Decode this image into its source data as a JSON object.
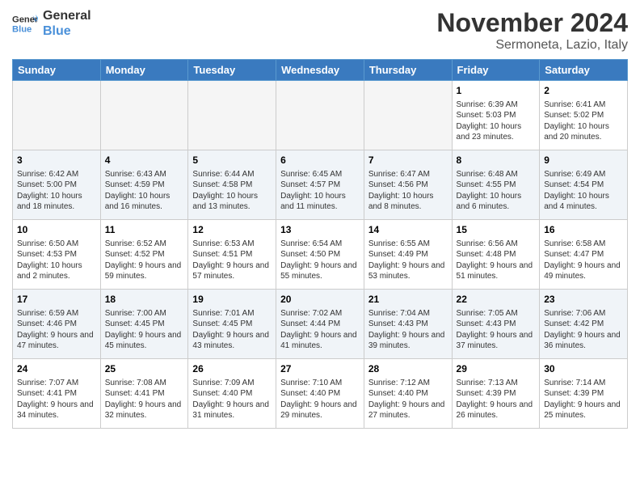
{
  "header": {
    "logo_line1": "General",
    "logo_line2": "Blue",
    "month_title": "November 2024",
    "location": "Sermoneta, Lazio, Italy"
  },
  "weekdays": [
    "Sunday",
    "Monday",
    "Tuesday",
    "Wednesday",
    "Thursday",
    "Friday",
    "Saturday"
  ],
  "weeks": [
    [
      {
        "day": "",
        "info": ""
      },
      {
        "day": "",
        "info": ""
      },
      {
        "day": "",
        "info": ""
      },
      {
        "day": "",
        "info": ""
      },
      {
        "day": "",
        "info": ""
      },
      {
        "day": "1",
        "info": "Sunrise: 6:39 AM\nSunset: 5:03 PM\nDaylight: 10 hours and 23 minutes."
      },
      {
        "day": "2",
        "info": "Sunrise: 6:41 AM\nSunset: 5:02 PM\nDaylight: 10 hours and 20 minutes."
      }
    ],
    [
      {
        "day": "3",
        "info": "Sunrise: 6:42 AM\nSunset: 5:00 PM\nDaylight: 10 hours and 18 minutes."
      },
      {
        "day": "4",
        "info": "Sunrise: 6:43 AM\nSunset: 4:59 PM\nDaylight: 10 hours and 16 minutes."
      },
      {
        "day": "5",
        "info": "Sunrise: 6:44 AM\nSunset: 4:58 PM\nDaylight: 10 hours and 13 minutes."
      },
      {
        "day": "6",
        "info": "Sunrise: 6:45 AM\nSunset: 4:57 PM\nDaylight: 10 hours and 11 minutes."
      },
      {
        "day": "7",
        "info": "Sunrise: 6:47 AM\nSunset: 4:56 PM\nDaylight: 10 hours and 8 minutes."
      },
      {
        "day": "8",
        "info": "Sunrise: 6:48 AM\nSunset: 4:55 PM\nDaylight: 10 hours and 6 minutes."
      },
      {
        "day": "9",
        "info": "Sunrise: 6:49 AM\nSunset: 4:54 PM\nDaylight: 10 hours and 4 minutes."
      }
    ],
    [
      {
        "day": "10",
        "info": "Sunrise: 6:50 AM\nSunset: 4:53 PM\nDaylight: 10 hours and 2 minutes."
      },
      {
        "day": "11",
        "info": "Sunrise: 6:52 AM\nSunset: 4:52 PM\nDaylight: 9 hours and 59 minutes."
      },
      {
        "day": "12",
        "info": "Sunrise: 6:53 AM\nSunset: 4:51 PM\nDaylight: 9 hours and 57 minutes."
      },
      {
        "day": "13",
        "info": "Sunrise: 6:54 AM\nSunset: 4:50 PM\nDaylight: 9 hours and 55 minutes."
      },
      {
        "day": "14",
        "info": "Sunrise: 6:55 AM\nSunset: 4:49 PM\nDaylight: 9 hours and 53 minutes."
      },
      {
        "day": "15",
        "info": "Sunrise: 6:56 AM\nSunset: 4:48 PM\nDaylight: 9 hours and 51 minutes."
      },
      {
        "day": "16",
        "info": "Sunrise: 6:58 AM\nSunset: 4:47 PM\nDaylight: 9 hours and 49 minutes."
      }
    ],
    [
      {
        "day": "17",
        "info": "Sunrise: 6:59 AM\nSunset: 4:46 PM\nDaylight: 9 hours and 47 minutes."
      },
      {
        "day": "18",
        "info": "Sunrise: 7:00 AM\nSunset: 4:45 PM\nDaylight: 9 hours and 45 minutes."
      },
      {
        "day": "19",
        "info": "Sunrise: 7:01 AM\nSunset: 4:45 PM\nDaylight: 9 hours and 43 minutes."
      },
      {
        "day": "20",
        "info": "Sunrise: 7:02 AM\nSunset: 4:44 PM\nDaylight: 9 hours and 41 minutes."
      },
      {
        "day": "21",
        "info": "Sunrise: 7:04 AM\nSunset: 4:43 PM\nDaylight: 9 hours and 39 minutes."
      },
      {
        "day": "22",
        "info": "Sunrise: 7:05 AM\nSunset: 4:43 PM\nDaylight: 9 hours and 37 minutes."
      },
      {
        "day": "23",
        "info": "Sunrise: 7:06 AM\nSunset: 4:42 PM\nDaylight: 9 hours and 36 minutes."
      }
    ],
    [
      {
        "day": "24",
        "info": "Sunrise: 7:07 AM\nSunset: 4:41 PM\nDaylight: 9 hours and 34 minutes."
      },
      {
        "day": "25",
        "info": "Sunrise: 7:08 AM\nSunset: 4:41 PM\nDaylight: 9 hours and 32 minutes."
      },
      {
        "day": "26",
        "info": "Sunrise: 7:09 AM\nSunset: 4:40 PM\nDaylight: 9 hours and 31 minutes."
      },
      {
        "day": "27",
        "info": "Sunrise: 7:10 AM\nSunset: 4:40 PM\nDaylight: 9 hours and 29 minutes."
      },
      {
        "day": "28",
        "info": "Sunrise: 7:12 AM\nSunset: 4:40 PM\nDaylight: 9 hours and 27 minutes."
      },
      {
        "day": "29",
        "info": "Sunrise: 7:13 AM\nSunset: 4:39 PM\nDaylight: 9 hours and 26 minutes."
      },
      {
        "day": "30",
        "info": "Sunrise: 7:14 AM\nSunset: 4:39 PM\nDaylight: 9 hours and 25 minutes."
      }
    ]
  ]
}
